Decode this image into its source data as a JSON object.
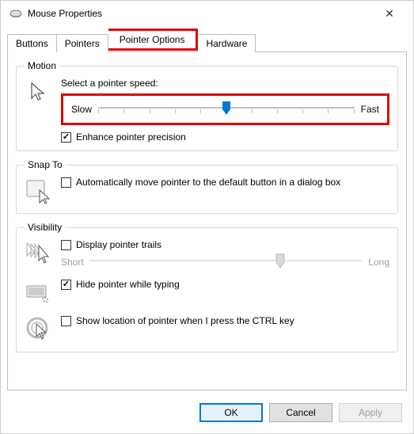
{
  "window": {
    "title": "Mouse Properties"
  },
  "tabs": {
    "buttons": "Buttons",
    "pointers": "Pointers",
    "pointer_options": "Pointer Options",
    "hardware": "Hardware"
  },
  "motion": {
    "legend": "Motion",
    "select_label": "Select a pointer speed:",
    "slow": "Slow",
    "fast": "Fast",
    "enhance_label": "Enhance pointer precision",
    "enhance_checked": true
  },
  "snap": {
    "legend": "Snap To",
    "auto_label": "Automatically move pointer to the default button in a dialog box",
    "auto_checked": false
  },
  "visibility": {
    "legend": "Visibility",
    "trails_label": "Display pointer trails",
    "trails_checked": false,
    "short": "Short",
    "long": "Long",
    "hide_label": "Hide pointer while typing",
    "hide_checked": true,
    "ctrl_label": "Show location of pointer when I press the CTRL key",
    "ctrl_checked": false
  },
  "buttons": {
    "ok": "OK",
    "cancel": "Cancel",
    "apply": "Apply"
  }
}
